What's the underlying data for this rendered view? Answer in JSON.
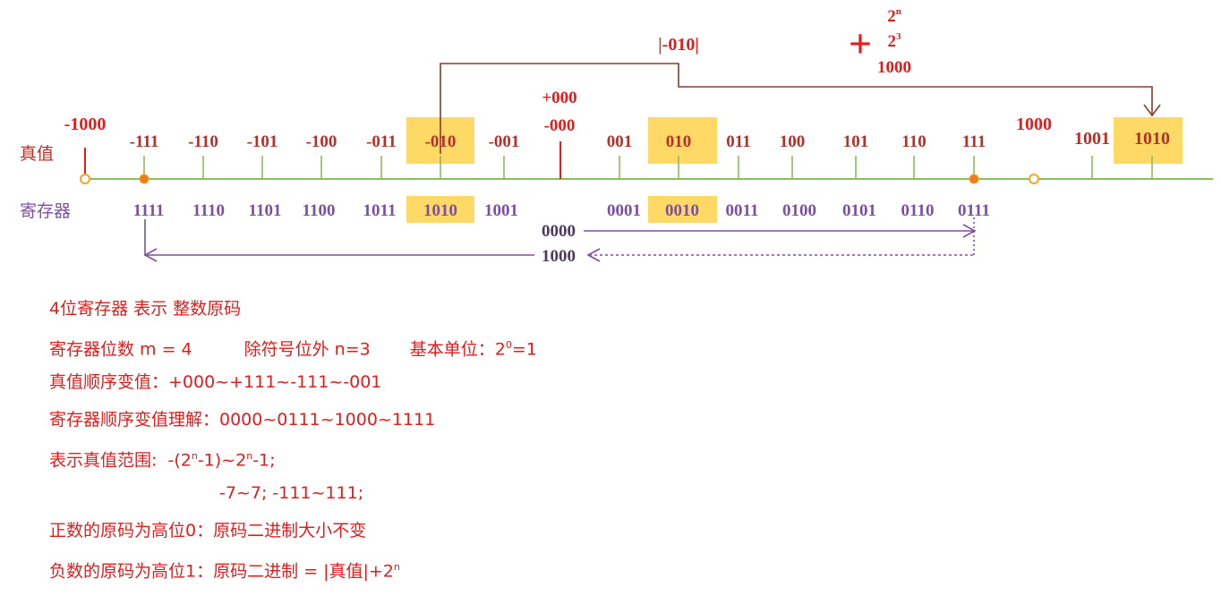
{
  "colors": {
    "red": "#e31c1c",
    "dark_red": "#b5302a",
    "brown_line": "#8b3a2e",
    "purple": "#7c4fa5",
    "green": "#8bbf5a",
    "highlight": "#ffd966",
    "orange_dot": "#f07a1c"
  },
  "labels": {
    "truth": "真值",
    "register": "寄存器"
  },
  "top": {
    "abs_label": "|-010|",
    "plus": "+",
    "pow_n": "2",
    "pow_n_sup": "n",
    "pow_3": "2",
    "pow_3_sup": "3",
    "thousand": "1000"
  },
  "zero_labels": {
    "pos": "+000",
    "neg": "-000"
  },
  "truth_values": [
    "-1000",
    "-111",
    "-110",
    "-101",
    "-100",
    "-011",
    "-010",
    "-001",
    "001",
    "010",
    "011",
    "100",
    "101",
    "110",
    "111",
    "1000",
    "1001",
    "1010"
  ],
  "register_values": [
    "1111",
    "1110",
    "1101",
    "1100",
    "1011",
    "1010",
    "1001",
    "0001",
    "0010",
    "0011",
    "0100",
    "0101",
    "0110",
    "0111"
  ],
  "arrow_labels": {
    "top": "0000",
    "bottom": "1000"
  },
  "notes": [
    {
      "text": "4位寄存器 表示 整数原码"
    },
    {
      "parts": [
        "寄存器位数 m = 4",
        "除符号位外 n=3",
        "基本单位：2",
        "0",
        "=1"
      ]
    },
    {
      "text": "真值顺序变值：+000~+111~-111~-001"
    },
    {
      "text": "寄存器顺序变值理解：0000~0111~1000~1111"
    },
    {
      "parts": [
        "表示真值范围:  -(2",
        "n",
        "-1)~2",
        "n",
        "-1;"
      ]
    },
    {
      "text": "-7~7; -111~111;"
    },
    {
      "text": "正数的原码为高位0：原码二进制大小不变"
    },
    {
      "parts": [
        "负数的原码为高位1：原码二进制 = |真值|+2",
        "n"
      ]
    }
  ]
}
